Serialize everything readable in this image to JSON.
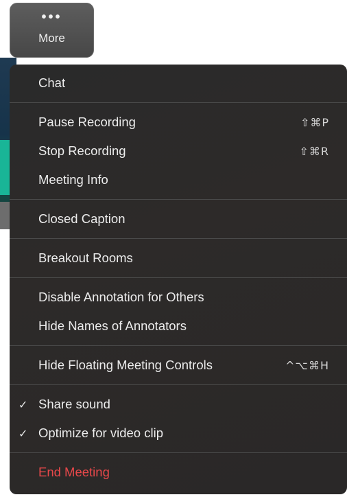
{
  "toolbar": {
    "more_button": {
      "icon_glyph": "•••",
      "label": "More"
    }
  },
  "menu": {
    "groups": [
      [
        {
          "label": "Chat",
          "shortcut": "",
          "checked": false
        }
      ],
      [
        {
          "label": "Pause Recording",
          "shortcut": "⇧⌘P",
          "checked": false
        },
        {
          "label": "Stop Recording",
          "shortcut": "⇧⌘R",
          "checked": false
        },
        {
          "label": "Meeting Info",
          "shortcut": "",
          "checked": false
        }
      ],
      [
        {
          "label": "Closed Caption",
          "shortcut": "",
          "checked": false
        }
      ],
      [
        {
          "label": "Breakout Rooms",
          "shortcut": "",
          "checked": false
        }
      ],
      [
        {
          "label": "Disable Annotation for Others",
          "shortcut": "",
          "checked": false
        },
        {
          "label": "Hide Names of Annotators",
          "shortcut": "",
          "checked": false
        }
      ],
      [
        {
          "label": "Hide Floating Meeting Controls",
          "shortcut": "^⌥⌘H",
          "checked": false
        }
      ],
      [
        {
          "label": "Share sound",
          "shortcut": "",
          "checked": true
        },
        {
          "label": "Optimize for video clip",
          "shortcut": "",
          "checked": true
        }
      ],
      [
        {
          "label": "End Meeting",
          "shortcut": "",
          "checked": false,
          "danger": true
        }
      ]
    ],
    "check_glyph": "✓"
  },
  "colors": {
    "menu_bg": "#2a2a2a",
    "danger": "#e8484a",
    "text": "#ececec",
    "separator": "#4a4a4a"
  }
}
